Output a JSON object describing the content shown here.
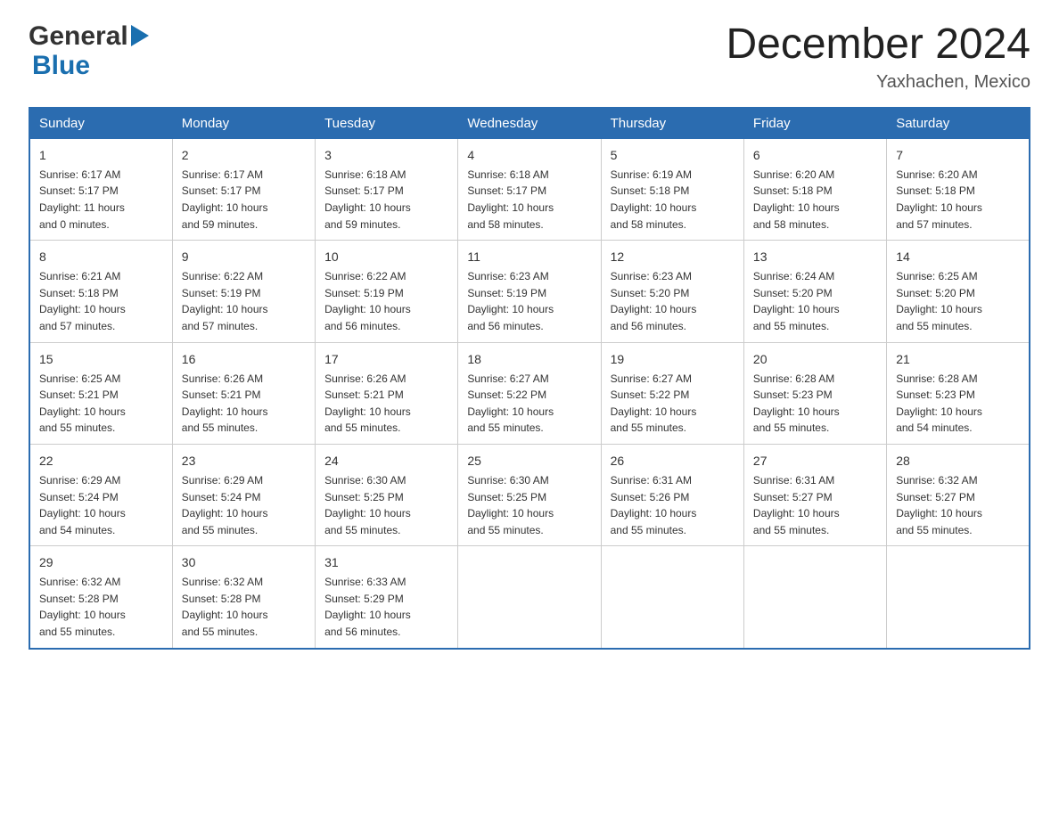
{
  "logo": {
    "text_general": "General",
    "text_blue": "Blue"
  },
  "title": {
    "month_year": "December 2024",
    "location": "Yaxhachen, Mexico"
  },
  "days_of_week": [
    "Sunday",
    "Monday",
    "Tuesday",
    "Wednesday",
    "Thursday",
    "Friday",
    "Saturday"
  ],
  "weeks": [
    [
      {
        "day": "1",
        "sunrise": "6:17 AM",
        "sunset": "5:17 PM",
        "daylight": "11 hours and 0 minutes."
      },
      {
        "day": "2",
        "sunrise": "6:17 AM",
        "sunset": "5:17 PM",
        "daylight": "10 hours and 59 minutes."
      },
      {
        "day": "3",
        "sunrise": "6:18 AM",
        "sunset": "5:17 PM",
        "daylight": "10 hours and 59 minutes."
      },
      {
        "day": "4",
        "sunrise": "6:18 AM",
        "sunset": "5:17 PM",
        "daylight": "10 hours and 58 minutes."
      },
      {
        "day": "5",
        "sunrise": "6:19 AM",
        "sunset": "5:18 PM",
        "daylight": "10 hours and 58 minutes."
      },
      {
        "day": "6",
        "sunrise": "6:20 AM",
        "sunset": "5:18 PM",
        "daylight": "10 hours and 58 minutes."
      },
      {
        "day": "7",
        "sunrise": "6:20 AM",
        "sunset": "5:18 PM",
        "daylight": "10 hours and 57 minutes."
      }
    ],
    [
      {
        "day": "8",
        "sunrise": "6:21 AM",
        "sunset": "5:18 PM",
        "daylight": "10 hours and 57 minutes."
      },
      {
        "day": "9",
        "sunrise": "6:22 AM",
        "sunset": "5:19 PM",
        "daylight": "10 hours and 57 minutes."
      },
      {
        "day": "10",
        "sunrise": "6:22 AM",
        "sunset": "5:19 PM",
        "daylight": "10 hours and 56 minutes."
      },
      {
        "day": "11",
        "sunrise": "6:23 AM",
        "sunset": "5:19 PM",
        "daylight": "10 hours and 56 minutes."
      },
      {
        "day": "12",
        "sunrise": "6:23 AM",
        "sunset": "5:20 PM",
        "daylight": "10 hours and 56 minutes."
      },
      {
        "day": "13",
        "sunrise": "6:24 AM",
        "sunset": "5:20 PM",
        "daylight": "10 hours and 55 minutes."
      },
      {
        "day": "14",
        "sunrise": "6:25 AM",
        "sunset": "5:20 PM",
        "daylight": "10 hours and 55 minutes."
      }
    ],
    [
      {
        "day": "15",
        "sunrise": "6:25 AM",
        "sunset": "5:21 PM",
        "daylight": "10 hours and 55 minutes."
      },
      {
        "day": "16",
        "sunrise": "6:26 AM",
        "sunset": "5:21 PM",
        "daylight": "10 hours and 55 minutes."
      },
      {
        "day": "17",
        "sunrise": "6:26 AM",
        "sunset": "5:21 PM",
        "daylight": "10 hours and 55 minutes."
      },
      {
        "day": "18",
        "sunrise": "6:27 AM",
        "sunset": "5:22 PM",
        "daylight": "10 hours and 55 minutes."
      },
      {
        "day": "19",
        "sunrise": "6:27 AM",
        "sunset": "5:22 PM",
        "daylight": "10 hours and 55 minutes."
      },
      {
        "day": "20",
        "sunrise": "6:28 AM",
        "sunset": "5:23 PM",
        "daylight": "10 hours and 55 minutes."
      },
      {
        "day": "21",
        "sunrise": "6:28 AM",
        "sunset": "5:23 PM",
        "daylight": "10 hours and 54 minutes."
      }
    ],
    [
      {
        "day": "22",
        "sunrise": "6:29 AM",
        "sunset": "5:24 PM",
        "daylight": "10 hours and 54 minutes."
      },
      {
        "day": "23",
        "sunrise": "6:29 AM",
        "sunset": "5:24 PM",
        "daylight": "10 hours and 55 minutes."
      },
      {
        "day": "24",
        "sunrise": "6:30 AM",
        "sunset": "5:25 PM",
        "daylight": "10 hours and 55 minutes."
      },
      {
        "day": "25",
        "sunrise": "6:30 AM",
        "sunset": "5:25 PM",
        "daylight": "10 hours and 55 minutes."
      },
      {
        "day": "26",
        "sunrise": "6:31 AM",
        "sunset": "5:26 PM",
        "daylight": "10 hours and 55 minutes."
      },
      {
        "day": "27",
        "sunrise": "6:31 AM",
        "sunset": "5:27 PM",
        "daylight": "10 hours and 55 minutes."
      },
      {
        "day": "28",
        "sunrise": "6:32 AM",
        "sunset": "5:27 PM",
        "daylight": "10 hours and 55 minutes."
      }
    ],
    [
      {
        "day": "29",
        "sunrise": "6:32 AM",
        "sunset": "5:28 PM",
        "daylight": "10 hours and 55 minutes."
      },
      {
        "day": "30",
        "sunrise": "6:32 AM",
        "sunset": "5:28 PM",
        "daylight": "10 hours and 55 minutes."
      },
      {
        "day": "31",
        "sunrise": "6:33 AM",
        "sunset": "5:29 PM",
        "daylight": "10 hours and 56 minutes."
      },
      null,
      null,
      null,
      null
    ]
  ],
  "labels": {
    "sunrise_prefix": "Sunrise: ",
    "sunset_prefix": "Sunset: ",
    "daylight_prefix": "Daylight: "
  }
}
